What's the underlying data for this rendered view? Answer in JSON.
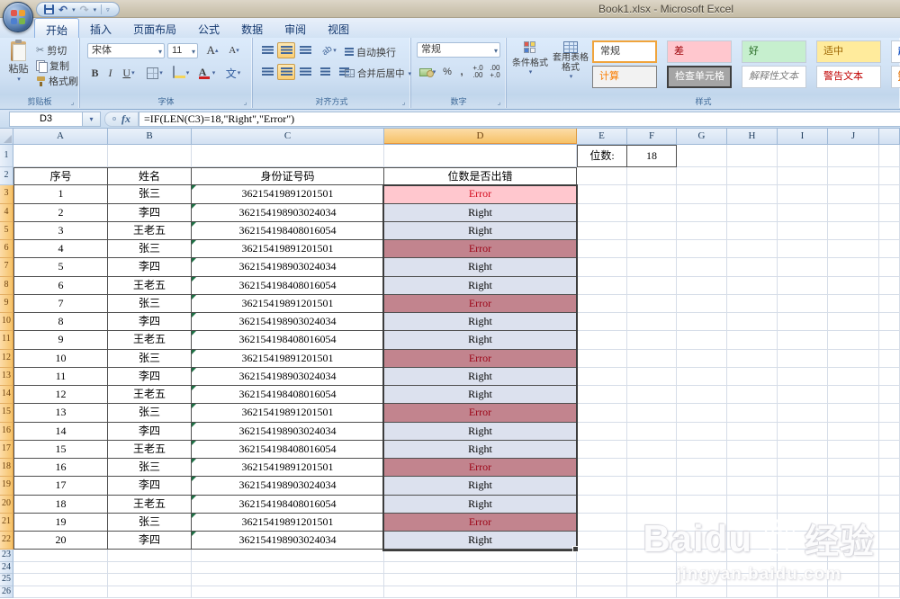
{
  "title_bar": {
    "title": "Book1.xlsx - Microsoft Excel"
  },
  "ribbon": {
    "tabs": [
      {
        "label": "开始",
        "active": true
      },
      {
        "label": "插入"
      },
      {
        "label": "页面布局"
      },
      {
        "label": "公式"
      },
      {
        "label": "数据"
      },
      {
        "label": "审阅"
      },
      {
        "label": "视图"
      }
    ],
    "clipboard": {
      "label": "剪贴板",
      "paste": "粘贴",
      "cut": "剪切",
      "copy": "复制",
      "format_painter": "格式刷"
    },
    "font": {
      "label": "字体",
      "name": "宋体",
      "size": "11",
      "bold": "B",
      "italic": "I",
      "underline": "U"
    },
    "alignment": {
      "label": "对齐方式",
      "wrap": "自动换行",
      "merge": "合并后居中"
    },
    "number": {
      "label": "数字",
      "format": "常规",
      "percent": "%",
      "comma": ","
    },
    "styles": {
      "label": "样式",
      "conditional": "条件格式",
      "format_table": "套用表格格式",
      "cells": [
        "常规",
        "差",
        "好",
        "适中",
        "计算",
        "检查单元格",
        "解释性文本",
        "警告文本"
      ],
      "partial_cells": [
        "超",
        "链"
      ]
    }
  },
  "formula_bar": {
    "name_box": "D3",
    "fx": "fx",
    "formula": "=IF(LEN(C3)=18,\"Right\",\"Error\")"
  },
  "sheet": {
    "column_headers": [
      "A",
      "B",
      "C",
      "D",
      "E",
      "F",
      "G",
      "H",
      "I",
      "J"
    ],
    "row_count": 26,
    "selected_column": "D",
    "selected_row_start": 3,
    "selected_row_end": 22,
    "digit_label": "位数:",
    "digit_value": "18",
    "table": {
      "headers": [
        "序号",
        "姓名",
        "身份证号码",
        "位数是否出错"
      ],
      "rows": [
        [
          "1",
          "张三",
          "36215419891201501",
          "Error"
        ],
        [
          "2",
          "李四",
          "362154198903024034",
          "Right"
        ],
        [
          "3",
          "王老五",
          "362154198408016054",
          "Right"
        ],
        [
          "4",
          "张三",
          "36215419891201501",
          "Error"
        ],
        [
          "5",
          "李四",
          "362154198903024034",
          "Right"
        ],
        [
          "6",
          "王老五",
          "362154198408016054",
          "Right"
        ],
        [
          "7",
          "张三",
          "36215419891201501",
          "Error"
        ],
        [
          "8",
          "李四",
          "362154198903024034",
          "Right"
        ],
        [
          "9",
          "王老五",
          "362154198408016054",
          "Right"
        ],
        [
          "10",
          "张三",
          "36215419891201501",
          "Error"
        ],
        [
          "11",
          "李四",
          "362154198903024034",
          "Right"
        ],
        [
          "12",
          "王老五",
          "362154198408016054",
          "Right"
        ],
        [
          "13",
          "张三",
          "36215419891201501",
          "Error"
        ],
        [
          "14",
          "李四",
          "362154198903024034",
          "Right"
        ],
        [
          "15",
          "王老五",
          "362154198408016054",
          "Right"
        ],
        [
          "16",
          "张三",
          "36215419891201501",
          "Error"
        ],
        [
          "17",
          "李四",
          "362154198903024034",
          "Right"
        ],
        [
          "18",
          "王老五",
          "362154198408016054",
          "Right"
        ],
        [
          "19",
          "张三",
          "36215419891201501",
          "Error"
        ],
        [
          "20",
          "李四",
          "362154198903024034",
          "Right"
        ]
      ]
    }
  },
  "watermark": {
    "brand_latin": "Baidu",
    "brand_cn": "经验",
    "url": "jingyan.baidu.com"
  },
  "colors": {
    "titlebar": "#CDC5B1",
    "ribbon_bg": "#CFE0F2",
    "selection_header_orange": "#F6C267",
    "error_bg_active": "#FFC7CE",
    "error_text": "#9C0006",
    "error_bg_in_selection": "#C2848E",
    "right_bg_in_selection": "#DCE1EE",
    "table_border": "#4F4F4F",
    "gridline": "#D6DDE8"
  }
}
